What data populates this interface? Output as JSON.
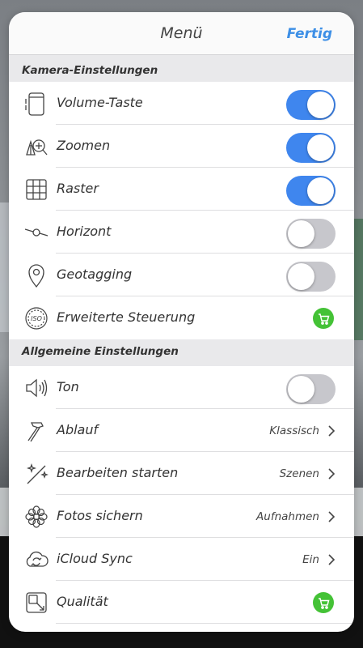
{
  "navbar": {
    "title": "Menü",
    "done_label": "Fertig"
  },
  "colors": {
    "accent": "#3d8fe6",
    "toggle_on": "#3f86ee",
    "toggle_off": "#c7c7cc",
    "cart_green": "#44c236"
  },
  "sections": {
    "camera": {
      "header": "Kamera-Einstellungen",
      "items": [
        {
          "label": "Volume-Taste",
          "icon": "phone-volume-icon",
          "toggle": true
        },
        {
          "label": "Zoomen",
          "icon": "zoom-icon",
          "toggle": true
        },
        {
          "label": "Raster",
          "icon": "grid-icon",
          "toggle": true
        },
        {
          "label": "Horizont",
          "icon": "horizon-icon",
          "toggle": false
        },
        {
          "label": "Geotagging",
          "icon": "location-pin-icon",
          "toggle": false
        },
        {
          "label": "Erweiterte Steuerung",
          "icon": "iso-icon",
          "badge": "cart-icon"
        }
      ]
    },
    "general": {
      "header": "Allgemeine Einstellungen",
      "items": [
        {
          "label": "Ton",
          "icon": "speaker-icon",
          "toggle": false
        },
        {
          "label": "Ablauf",
          "icon": "hammer-icon",
          "value": "Klassisch"
        },
        {
          "label": "Bearbeiten starten",
          "icon": "magic-wand-icon",
          "value": "Szenen"
        },
        {
          "label": "Fotos sichern",
          "icon": "flower-icon",
          "value": "Aufnahmen"
        },
        {
          "label": "iCloud Sync",
          "icon": "cloud-sync-icon",
          "value": "Ein"
        },
        {
          "label": "Qualität",
          "icon": "quality-icon",
          "badge": "cart-icon"
        }
      ]
    }
  }
}
